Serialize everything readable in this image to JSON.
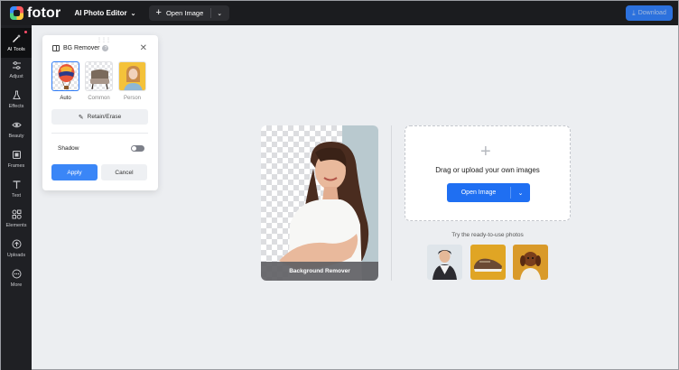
{
  "app": {
    "logo_text": "fotor",
    "editor_menu": "AI Photo Editor",
    "open_image_label": "Open Image",
    "download_label": "Download"
  },
  "sidebar": {
    "items": [
      {
        "label": "AI Tools",
        "icon": "magic-wand-icon"
      },
      {
        "label": "Adjust",
        "icon": "sliders-icon"
      },
      {
        "label": "Effects",
        "icon": "flask-icon"
      },
      {
        "label": "Beauty",
        "icon": "eye-icon"
      },
      {
        "label": "Frames",
        "icon": "frame-icon"
      },
      {
        "label": "Text",
        "icon": "text-icon"
      },
      {
        "label": "Elements",
        "icon": "shapes-icon"
      },
      {
        "label": "Uploads",
        "icon": "upload-icon"
      },
      {
        "label": "More",
        "icon": "more-icon"
      }
    ]
  },
  "panel": {
    "title": "BG Remover",
    "options": [
      {
        "label": "Auto"
      },
      {
        "label": "Common"
      },
      {
        "label": "Person"
      }
    ],
    "retain_label": "Retain/Erase",
    "shadow_label": "Shadow",
    "apply_label": "Apply",
    "cancel_label": "Cancel"
  },
  "preview": {
    "caption": "Background Remover"
  },
  "upload": {
    "text": "Drag or upload your own images",
    "button_label": "Open Image"
  },
  "ready": {
    "text": "Try the ready-to-use photos"
  },
  "colors": {
    "accent": "#2f7cf6",
    "topbar": "#1b1c1f",
    "canvas": "#eceef1"
  }
}
